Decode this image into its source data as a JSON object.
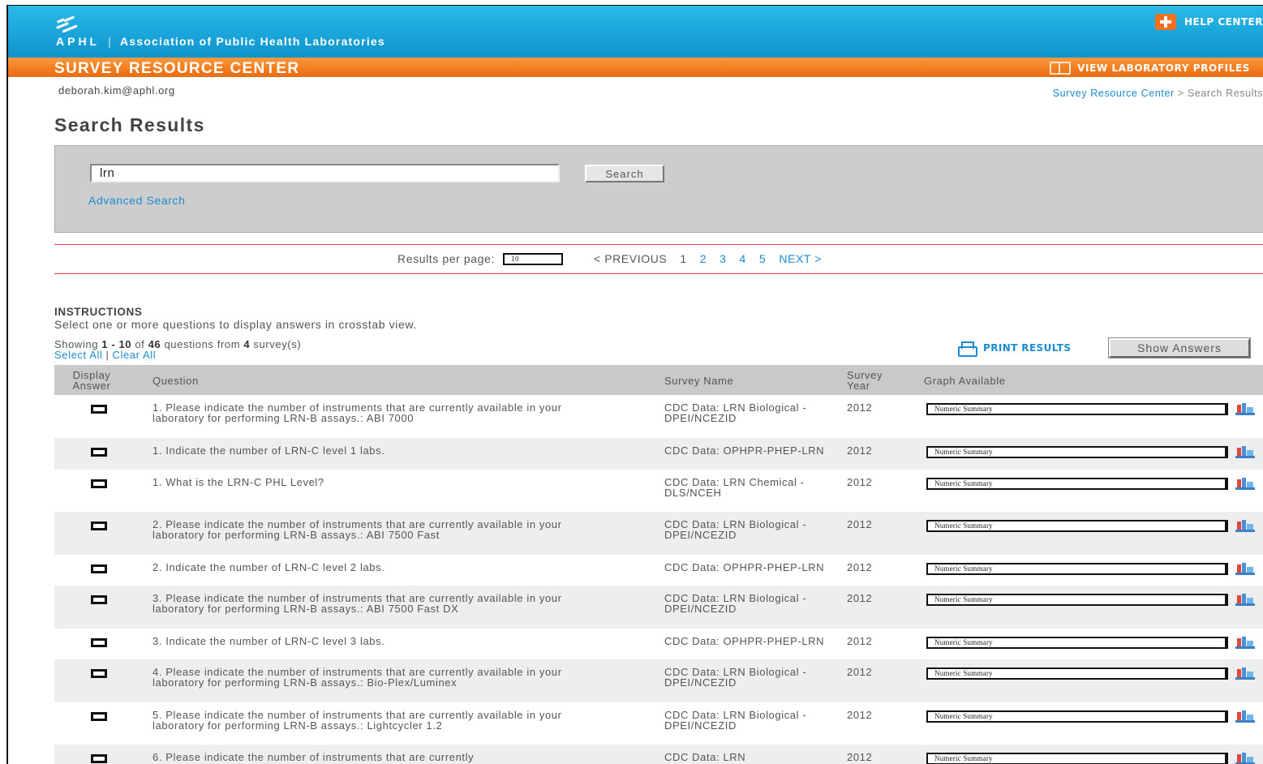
{
  "header": {
    "org_abbr": "APHL",
    "org_name": "Association of Public Health Laboratories",
    "help_label": "HELP CENTER",
    "section_title": "SURVEY RESOURCE CENTER",
    "profiles_label": "VIEW LABORATORY PROFILES",
    "colors": {
      "blue": "#1aa5da",
      "orange": "#f37c1e",
      "link": "#1a8ccf"
    }
  },
  "user": {
    "email": "deborah.kim@aphl.org"
  },
  "breadcrumb": {
    "link": "Survey Resource Center",
    "separator": ">",
    "current": "Search Results"
  },
  "page": {
    "title": "Search Results"
  },
  "search": {
    "value": "lrn",
    "button": "Search",
    "advanced": "Advanced Search"
  },
  "pager": {
    "label": "Results per page:",
    "per_page": "10",
    "prev": "< PREVIOUS",
    "current": "1",
    "pages": [
      "2",
      "3",
      "4",
      "5"
    ],
    "next": "NEXT >"
  },
  "instructions": {
    "heading": "INSTRUCTIONS",
    "text": "Select one or more questions to display answers in crosstab view."
  },
  "summary": {
    "prefix": "Showing ",
    "range": "1 - 10",
    "of": " of ",
    "total": "46",
    "mid": " questions from ",
    "surveys": "4",
    "suffix": " survey(s)",
    "select_all": "Select All",
    "divider": "|",
    "clear_all": "Clear All"
  },
  "actions": {
    "print": "PRINT RESULTS",
    "show_answers": "Show Answers"
  },
  "table": {
    "headers": {
      "display_answer": "Display Answer",
      "question": "Question",
      "survey_name": "Survey Name",
      "survey_year": "Survey Year",
      "graph_available": "Graph Available"
    },
    "rows": [
      {
        "question": "1. Please indicate the number of instruments that are currently available in your laboratory for performing LRN-B assays.: ABI 7000",
        "survey": "CDC Data: LRN Biological - DPEI/NCEZID",
        "year": "2012",
        "graph": "Numeric Summary"
      },
      {
        "question": "1. Indicate the number of LRN-C level 1 labs.",
        "survey": "CDC Data: OPHPR-PHEP-LRN",
        "year": "2012",
        "graph": "Numeric Summary"
      },
      {
        "question": "1. What is the LRN-C PHL Level?",
        "survey": "CDC Data: LRN Chemical - DLS/NCEH",
        "year": "2012",
        "graph": "Numeric Summary"
      },
      {
        "question": "2. Please indicate the number of instruments that are currently available in your laboratory for performing LRN-B assays.: ABI 7500 Fast",
        "survey": "CDC Data: LRN Biological - DPEI/NCEZID",
        "year": "2012",
        "graph": "Numeric Summary"
      },
      {
        "question": "2. Indicate the number of LRN-C level 2 labs.",
        "survey": "CDC Data: OPHPR-PHEP-LRN",
        "year": "2012",
        "graph": "Numeric Summary"
      },
      {
        "question": "3. Please indicate the number of instruments that are currently available in your laboratory for performing LRN-B assays.: ABI 7500 Fast DX",
        "survey": "CDC Data: LRN Biological - DPEI/NCEZID",
        "year": "2012",
        "graph": "Numeric Summary"
      },
      {
        "question": "3. Indicate the number of LRN-C level 3 labs.",
        "survey": "CDC Data: OPHPR-PHEP-LRN",
        "year": "2012",
        "graph": "Numeric Summary"
      },
      {
        "question": "4. Please indicate the number of instruments that are currently available in your laboratory for performing LRN-B assays.: Bio-Plex/Luminex",
        "survey": "CDC Data: LRN Biological - DPEI/NCEZID",
        "year": "2012",
        "graph": "Numeric Summary"
      },
      {
        "question": "5. Please indicate the number of instruments that are currently available in your laboratory for performing LRN-B assays.: Lightcycler 1.2",
        "survey": "CDC Data: LRN Biological - DPEI/NCEZID",
        "year": "2012",
        "graph": "Numeric Summary"
      },
      {
        "question": "6. Please indicate the number of instruments that are currently",
        "survey": "CDC Data: LRN",
        "year": "2012",
        "graph": "Numeric Summary"
      }
    ]
  }
}
